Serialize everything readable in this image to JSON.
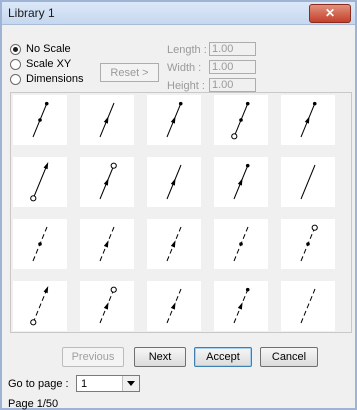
{
  "window": {
    "title": "Library 1",
    "close_label": "✕"
  },
  "scale_options": [
    {
      "label": "No Scale",
      "selected": true
    },
    {
      "label": "Scale XY",
      "selected": false
    },
    {
      "label": "Dimensions",
      "selected": false
    }
  ],
  "reset_label": "Reset >",
  "dimensions": {
    "length": {
      "label": "Length :",
      "value": "1.00"
    },
    "width": {
      "label": "Width :",
      "value": "1.00"
    },
    "height": {
      "label": "Height :",
      "value": "1.00"
    }
  },
  "symbols": [
    {
      "style": "solid",
      "start": "none",
      "mid": "dot",
      "end": "dot"
    },
    {
      "style": "solid",
      "start": "none",
      "mid": "arrow",
      "end": "none"
    },
    {
      "style": "solid",
      "start": "none",
      "mid": "arrow",
      "end": "dot"
    },
    {
      "style": "solid",
      "start": "circle",
      "mid": "dot",
      "end": "dot"
    },
    {
      "style": "solid",
      "start": "none",
      "mid": "arrow",
      "end": "dot"
    },
    {
      "style": "solid",
      "start": "circle",
      "mid": "none",
      "end": "arrow"
    },
    {
      "style": "solid",
      "start": "none",
      "mid": "arrow",
      "end": "circle"
    },
    {
      "style": "solid",
      "start": "none",
      "mid": "arrow",
      "end": "none"
    },
    {
      "style": "solid",
      "start": "none",
      "mid": "arrow",
      "end": "dot"
    },
    {
      "style": "solid",
      "start": "none",
      "mid": "none",
      "end": "none"
    },
    {
      "style": "dashed",
      "start": "none",
      "mid": "dot",
      "end": "none"
    },
    {
      "style": "dashed",
      "start": "none",
      "mid": "arrow",
      "end": "none"
    },
    {
      "style": "dashed",
      "start": "none",
      "mid": "arrow",
      "end": "none"
    },
    {
      "style": "dashed",
      "start": "none",
      "mid": "dot",
      "end": "none"
    },
    {
      "style": "dashed",
      "start": "none",
      "mid": "dot",
      "end": "circle"
    },
    {
      "style": "dashed",
      "start": "circle",
      "mid": "none",
      "end": "arrow"
    },
    {
      "style": "dashed",
      "start": "none",
      "mid": "arrow",
      "end": "circle"
    },
    {
      "style": "dashed",
      "start": "none",
      "mid": "arrow",
      "end": "none"
    },
    {
      "style": "dashed",
      "start": "none",
      "mid": "arrow",
      "end": "dot"
    },
    {
      "style": "dashed",
      "start": "none",
      "mid": "none",
      "end": "none"
    }
  ],
  "buttons": {
    "previous": "Previous",
    "next": "Next",
    "accept": "Accept",
    "cancel": "Cancel"
  },
  "goto": {
    "label": "Go to page :",
    "value": "1"
  },
  "page_status": "Page 1/50"
}
